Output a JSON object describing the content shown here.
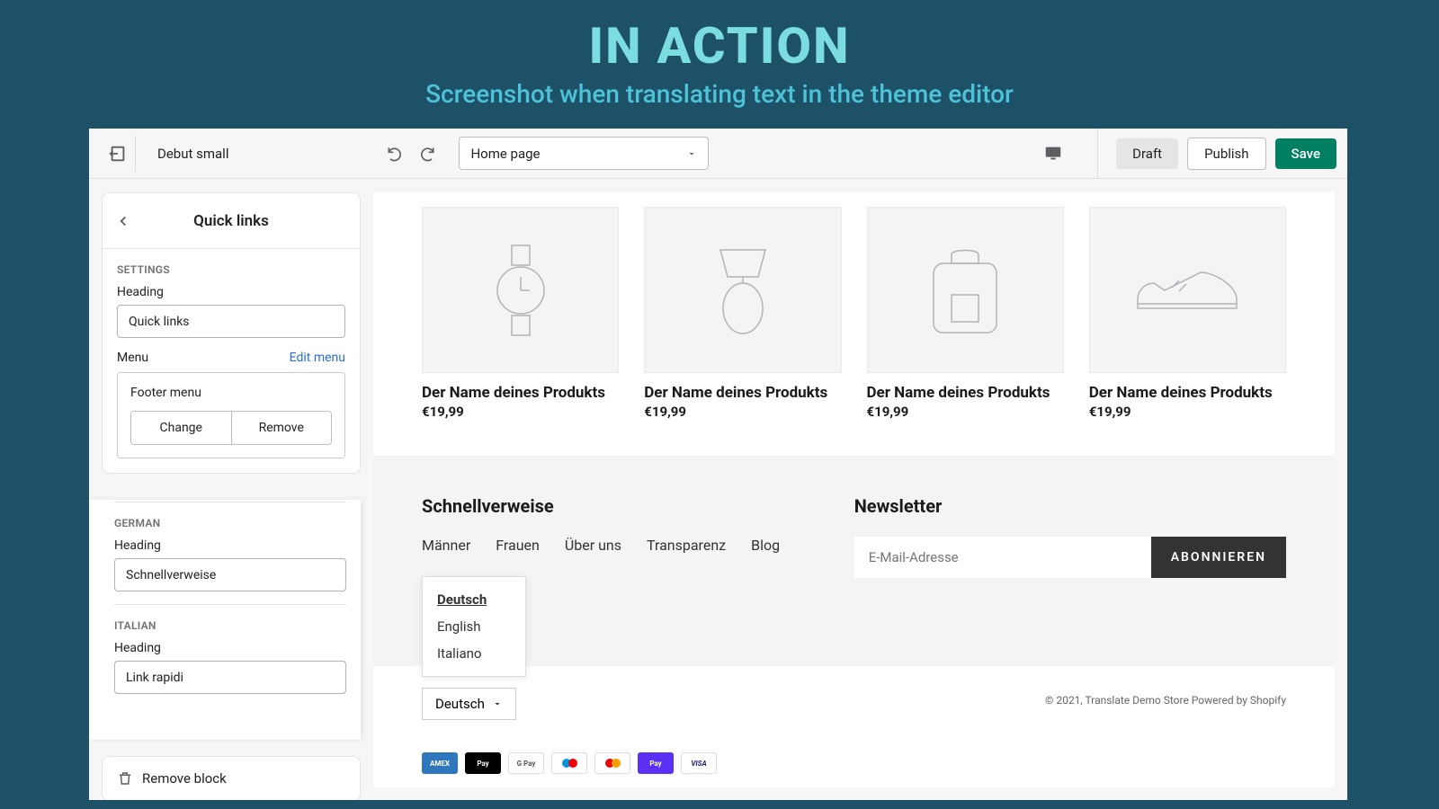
{
  "hero": {
    "title": "IN ACTION",
    "subtitle": "Screenshot when translating text in the theme editor"
  },
  "topbar": {
    "theme_name": "Debut small",
    "page_select": "Home page",
    "draft": "Draft",
    "publish": "Publish",
    "save": "Save"
  },
  "sidebar": {
    "back_icon": "chevron-left",
    "title": "Quick links",
    "settings_label": "SETTINGS",
    "heading_label": "Heading",
    "heading_value": "Quick links",
    "menu_label": "Menu",
    "edit_menu": "Edit menu",
    "menu_name": "Footer menu",
    "change": "Change",
    "remove": "Remove",
    "german": {
      "label": "GERMAN",
      "heading_label": "Heading",
      "value": "Schnellverweise"
    },
    "italian": {
      "label": "ITALIAN",
      "heading_label": "Heading",
      "value": "Link rapidi"
    },
    "remove_block": "Remove block"
  },
  "preview": {
    "products": [
      {
        "name": "Der Name deines Produkts",
        "price": "€19,99",
        "icon": "watch"
      },
      {
        "name": "Der Name deines Produkts",
        "price": "€19,99",
        "icon": "lamp"
      },
      {
        "name": "Der Name deines Produkts",
        "price": "€19,99",
        "icon": "backpack"
      },
      {
        "name": "Der Name deines Produkts",
        "price": "€19,99",
        "icon": "shoe"
      }
    ],
    "footer": {
      "quicklinks_title": "Schnellverweise",
      "links": [
        "Männer",
        "Frauen",
        "Über uns",
        "Transparenz",
        "Blog"
      ],
      "newsletter_title": "Newsletter",
      "email_placeholder": "E-Mail-Adresse",
      "subscribe": "ABONNIEREN"
    },
    "lang_popup": {
      "items": [
        "Deutsch",
        "English",
        "Italiano"
      ],
      "selected": "Deutsch"
    },
    "lang_selector": "Deutsch",
    "copyright": "© 2021, Translate Demo Store Powered by Shopify",
    "payments": [
      {
        "label": "AMEX",
        "bg": "#2e77bc"
      },
      {
        "label": "Pay",
        "bg": "#000000"
      },
      {
        "label": "G Pay",
        "bg": "#ffffff"
      },
      {
        "label": "",
        "bg": "#ffffff"
      },
      {
        "label": "",
        "bg": "#ffffff"
      },
      {
        "label": "Pay",
        "bg": "#5a31f4"
      },
      {
        "label": "VISA",
        "bg": "#ffffff"
      }
    ]
  }
}
